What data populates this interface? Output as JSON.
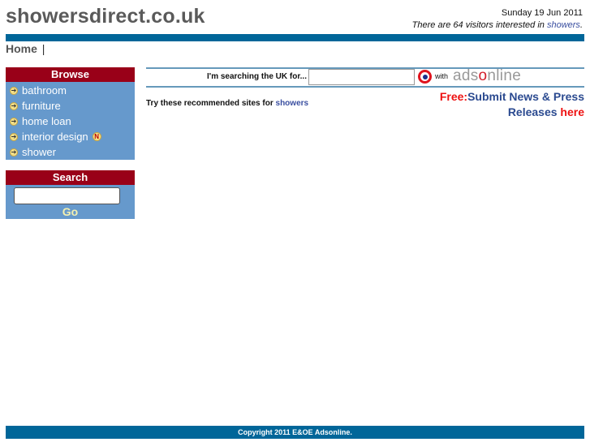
{
  "header": {
    "site_title": "showersdirect.co.uk",
    "date": "Sunday 19 Jun 2011",
    "visitors_prefix": "There are 64 visitors interested in ",
    "visitors_link": "showers",
    "visitors_suffix": ".",
    "brand_color": "#006699"
  },
  "breadcrumb": {
    "home": "Home",
    "separator": "|"
  },
  "browse": {
    "title": "Browse",
    "items": [
      {
        "label": "bathroom",
        "icon": "arrow-right-circle-icon"
      },
      {
        "label": "furniture",
        "icon": "arrow-right-circle-icon"
      },
      {
        "label": "home loan",
        "icon": "arrow-right-circle-icon"
      },
      {
        "label": "interior design",
        "icon": "arrow-right-circle-icon",
        "badge": "N"
      },
      {
        "label": "shower",
        "icon": "arrow-right-circle-icon"
      }
    ]
  },
  "search_panel": {
    "title": "Search",
    "input_value": "",
    "go_label": "Go"
  },
  "search_strip": {
    "label": "I'm searching the UK for...",
    "input_value": "",
    "with_label": "with",
    "logo_prefix": "ads",
    "logo_o": "o",
    "logo_suffix": "nline"
  },
  "recommended": {
    "text": "Try these recommended sites for ",
    "link": "showers"
  },
  "press": {
    "free": "Free:",
    "line1": "Submit News & Press",
    "line2": "Releases ",
    "here": "here"
  },
  "footer": {
    "copyright": "Copyright 2011 E&OE Adsonline."
  }
}
